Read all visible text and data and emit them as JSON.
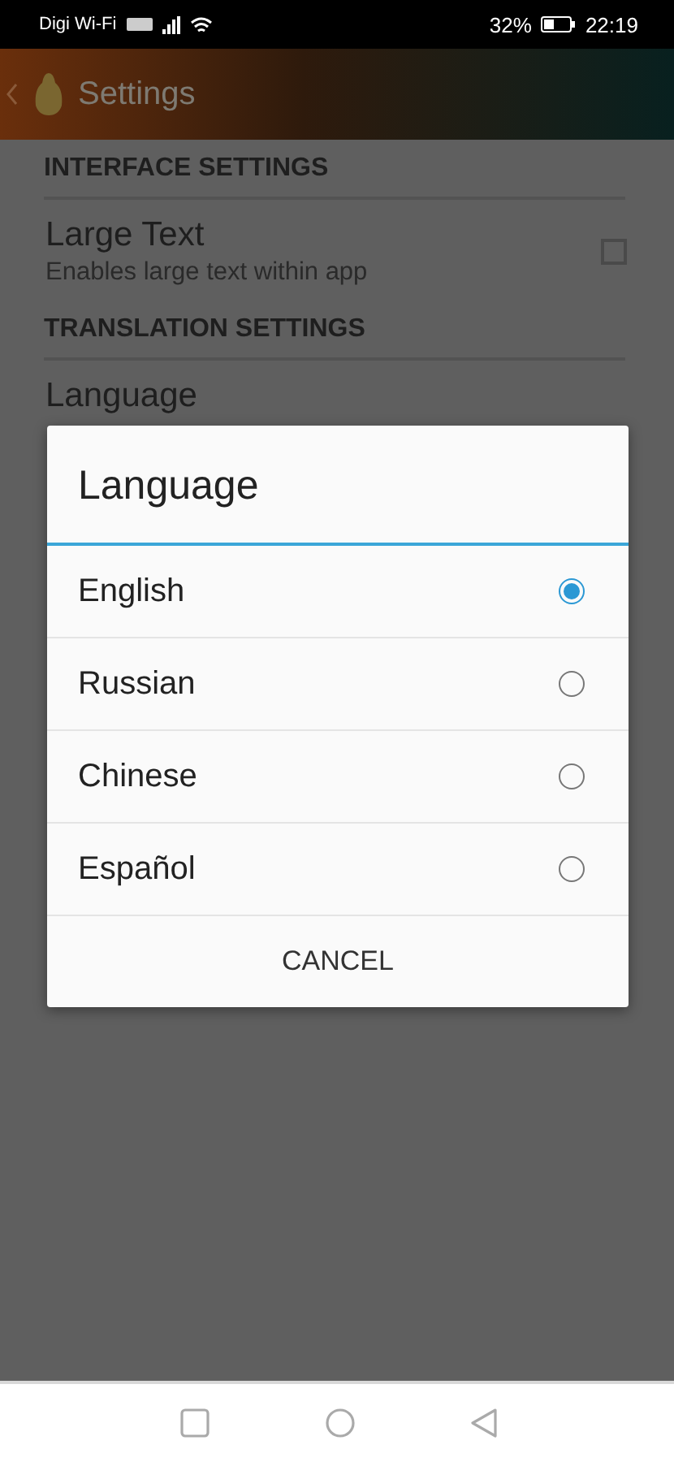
{
  "status_bar": {
    "carrier": "Digi Wi-Fi",
    "battery": "32%",
    "time": "22:19"
  },
  "app_bar": {
    "title": "Settings"
  },
  "sections": [
    {
      "header": "INTERFACE SETTINGS",
      "items": [
        {
          "kind": "checkbox",
          "title": "Large Text",
          "summary": "Enables large text within app",
          "checked": false
        }
      ]
    },
    {
      "header": "TRANSLATION SETTINGS",
      "items": [
        {
          "kind": "plain",
          "title": "Language"
        }
      ]
    }
  ],
  "dialog": {
    "title": "Language",
    "options": [
      {
        "label": "English",
        "selected": true
      },
      {
        "label": "Russian",
        "selected": false
      },
      {
        "label": "Chinese",
        "selected": false
      },
      {
        "label": "Español",
        "selected": false
      }
    ],
    "button": "CANCEL"
  }
}
